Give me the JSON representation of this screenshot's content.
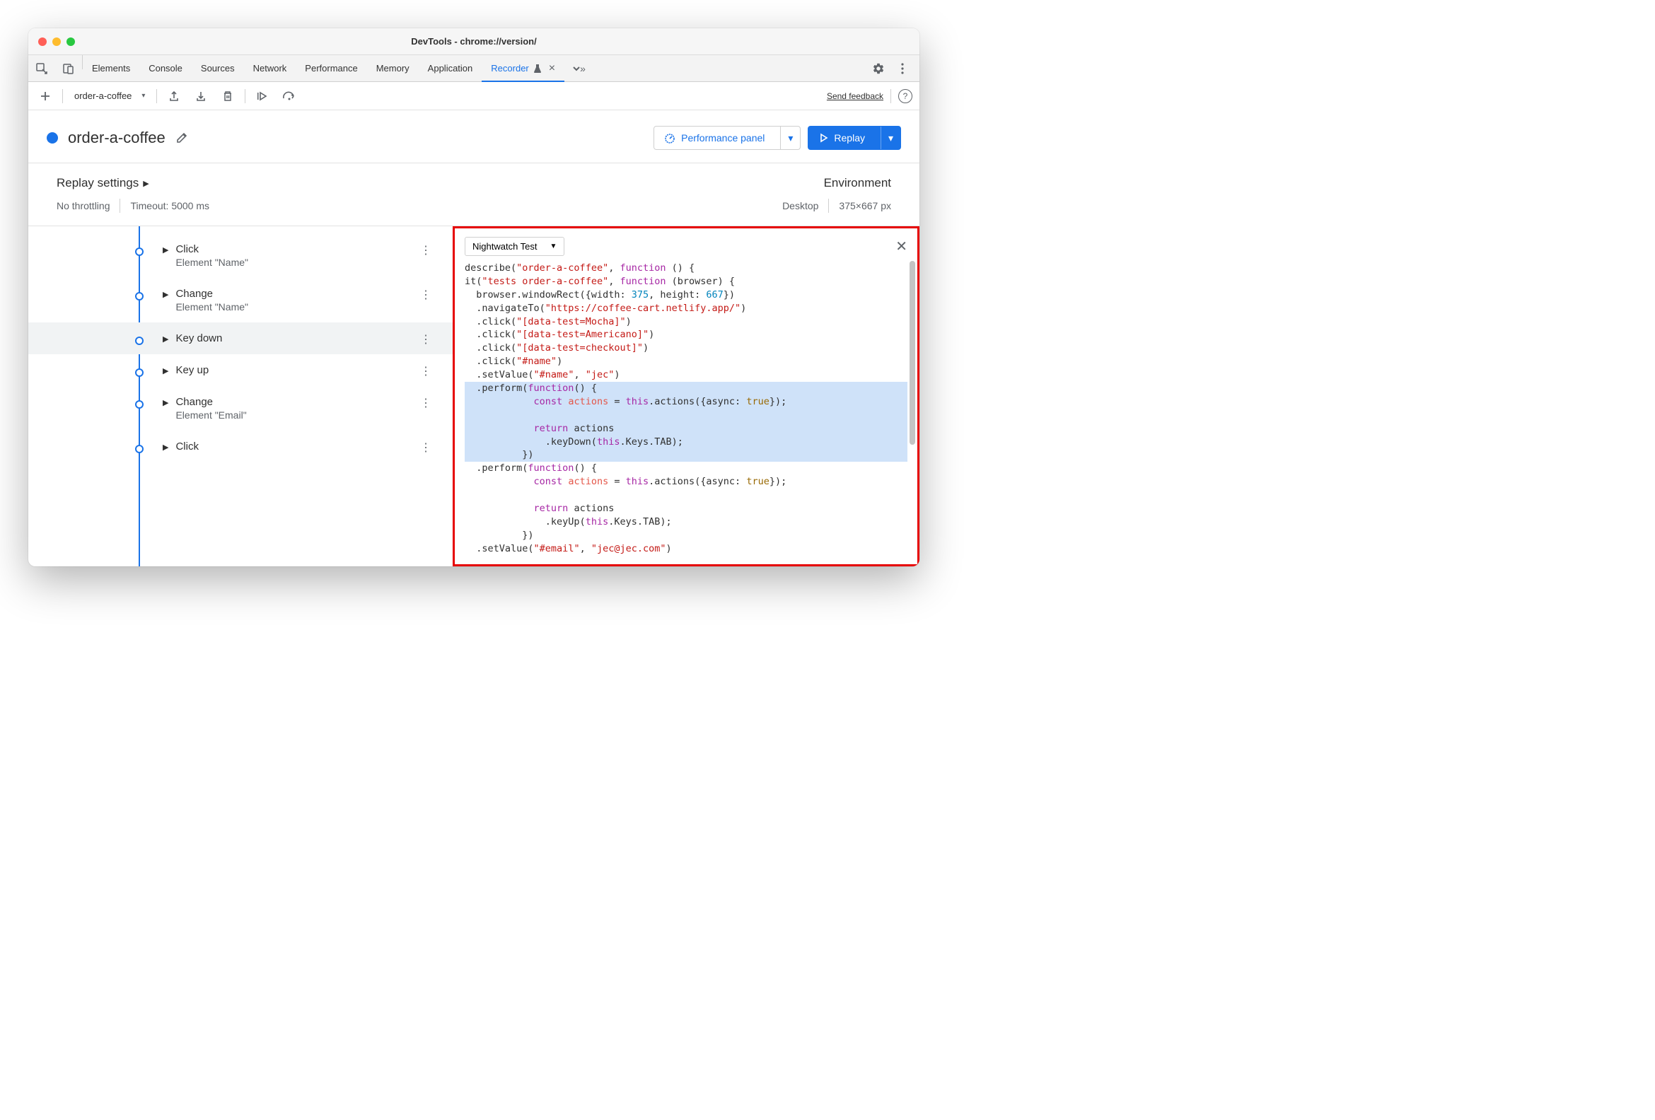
{
  "window": {
    "title": "DevTools - chrome://version/"
  },
  "tabs": {
    "items": [
      "Elements",
      "Console",
      "Sources",
      "Network",
      "Performance",
      "Memory",
      "Application",
      "Recorder"
    ],
    "active": "Recorder"
  },
  "recorder": {
    "recording_name": "order-a-coffee",
    "send_feedback": "Send feedback",
    "title": "order-a-coffee",
    "perf_button": "Performance panel",
    "replay_button": "Replay"
  },
  "settings": {
    "heading": "Replay settings",
    "throttling": "No throttling",
    "timeout": "Timeout: 5000 ms",
    "env_heading": "Environment",
    "env_device": "Desktop",
    "env_size": "375×667 px"
  },
  "steps": [
    {
      "title": "Click",
      "sub": "Element \"Name\""
    },
    {
      "title": "Change",
      "sub": "Element \"Name\""
    },
    {
      "title": "Key down",
      "sub": ""
    },
    {
      "title": "Key up",
      "sub": ""
    },
    {
      "title": "Change",
      "sub": "Element \"Email\""
    },
    {
      "title": "Click",
      "sub": ""
    }
  ],
  "export": {
    "dropdown_label": "Nightwatch Test",
    "tokens": [
      [
        "",
        "describe("
      ],
      [
        "str",
        "\"order-a-coffee\""
      ],
      [
        "",
        ", "
      ],
      [
        "kw",
        "function"
      ],
      [
        "",
        " () {\n"
      ],
      [
        "",
        "it("
      ],
      [
        "str",
        "\"tests order-a-coffee\""
      ],
      [
        "",
        ", "
      ],
      [
        "kw",
        "function"
      ],
      [
        "",
        " (browser) {\n"
      ],
      [
        "",
        "  browser.windowRect({width: "
      ],
      [
        "num",
        "375"
      ],
      [
        "",
        ", height: "
      ],
      [
        "num",
        "667"
      ],
      [
        "",
        "})\n"
      ],
      [
        "",
        "  .navigateTo("
      ],
      [
        "str",
        "\"https://coffee-cart.netlify.app/\""
      ],
      [
        "",
        ")\n"
      ],
      [
        "",
        "  .click("
      ],
      [
        "str",
        "\"[data-test=Mocha]\""
      ],
      [
        "",
        ")\n"
      ],
      [
        "",
        "  .click("
      ],
      [
        "str",
        "\"[data-test=Americano]\""
      ],
      [
        "",
        ")\n"
      ],
      [
        "",
        "  .click("
      ],
      [
        "str",
        "\"[data-test=checkout]\""
      ],
      [
        "",
        ")\n"
      ],
      [
        "",
        "  .click("
      ],
      [
        "str",
        "\"#name\""
      ],
      [
        "",
        ")\n"
      ],
      [
        "",
        "  .setValue("
      ],
      [
        "str",
        "\"#name\""
      ],
      [
        "",
        ", "
      ],
      [
        "str",
        "\"jec\""
      ],
      [
        "",
        ")\n"
      ],
      [
        "hl-start",
        ""
      ],
      [
        "",
        "  .perform("
      ],
      [
        "kw",
        "function"
      ],
      [
        "",
        "() {\n"
      ],
      [
        "",
        "            "
      ],
      [
        "kw",
        "const"
      ],
      [
        "",
        " "
      ],
      [
        "id",
        "actions"
      ],
      [
        "",
        " = "
      ],
      [
        "kw",
        "this"
      ],
      [
        "",
        ".actions({async: "
      ],
      [
        "bool",
        "true"
      ],
      [
        "",
        "});\n\n"
      ],
      [
        "",
        "            "
      ],
      [
        "kw",
        "return"
      ],
      [
        "",
        " actions\n"
      ],
      [
        "",
        "              .keyDown("
      ],
      [
        "kw",
        "this"
      ],
      [
        "",
        ".Keys.TAB);\n"
      ],
      [
        "",
        "          })\n"
      ],
      [
        "hl-end",
        ""
      ],
      [
        "",
        "  .perform("
      ],
      [
        "kw",
        "function"
      ],
      [
        "",
        "() {\n"
      ],
      [
        "",
        "            "
      ],
      [
        "kw",
        "const"
      ],
      [
        "",
        " "
      ],
      [
        "id",
        "actions"
      ],
      [
        "",
        " = "
      ],
      [
        "kw",
        "this"
      ],
      [
        "",
        ".actions({async: "
      ],
      [
        "bool",
        "true"
      ],
      [
        "",
        "});\n\n"
      ],
      [
        "",
        "            "
      ],
      [
        "kw",
        "return"
      ],
      [
        "",
        " actions\n"
      ],
      [
        "",
        "              .keyUp("
      ],
      [
        "kw",
        "this"
      ],
      [
        "",
        ".Keys.TAB);\n"
      ],
      [
        "",
        "          })\n"
      ],
      [
        "",
        "  .setValue("
      ],
      [
        "str",
        "\"#email\""
      ],
      [
        "",
        ", "
      ],
      [
        "str",
        "\"jec@jec.com\""
      ],
      [
        "",
        ")"
      ]
    ]
  }
}
